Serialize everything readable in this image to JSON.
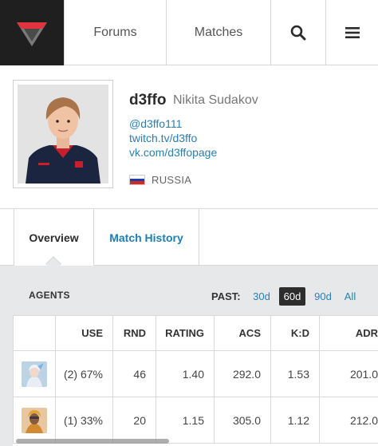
{
  "nav": {
    "logo_icon": "vlr-logo-icon",
    "forums_label": "Forums",
    "matches_label": "Matches",
    "search_icon": "search-icon",
    "menu_icon": "hamburger-menu-icon"
  },
  "player": {
    "alias": "d3ffo",
    "real_name": "Nikita Sudakov",
    "twitter": "@d3ffo111",
    "twitch": "twitch.tv/d3ffo",
    "vk": "vk.com/d3ffopage",
    "country": "RUSSIA",
    "flag_colors": [
      "#ffffff",
      "#1c3faa",
      "#d52b1e"
    ]
  },
  "tabs": {
    "overview": "Overview",
    "match_history": "Match History",
    "active": "overview"
  },
  "stats": {
    "section_title": "AGENTS",
    "past_label": "PAST:",
    "periods": [
      "30d",
      "60d",
      "90d",
      "All"
    ],
    "selected_period": "60d",
    "columns": [
      "",
      "USE",
      "RND",
      "RATING",
      "ACS",
      "K:D",
      "ADR"
    ],
    "rows": [
      {
        "agent_icon": "agent-portrait-icon",
        "use": "(2) 67%",
        "rnd": "46",
        "rating": "1.40",
        "acs": "292.0",
        "kd": "1.53",
        "adr": "201.0"
      },
      {
        "agent_icon": "agent-portrait-icon",
        "use": "(1) 33%",
        "rnd": "20",
        "rating": "1.15",
        "acs": "305.0",
        "kd": "1.12",
        "adr": "212.0"
      }
    ]
  },
  "colors": {
    "accent_link": "#2a7fb0",
    "logo_red": "#e0343f",
    "panel_bg": "#e7e8ea"
  }
}
